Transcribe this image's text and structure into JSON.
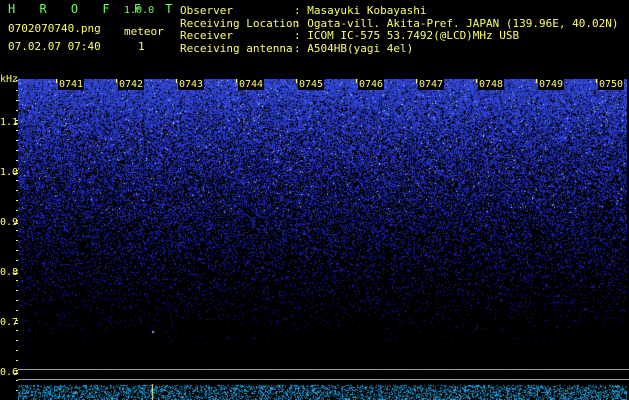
{
  "app": {
    "title_letters": "H R O F F T",
    "version": "1.0.0"
  },
  "file": {
    "name": "0702070740.png",
    "datetime": "07.02.07 07:40"
  },
  "meteor": {
    "label": "meteor",
    "count": "1"
  },
  "meta": [
    {
      "label": "Observer",
      "value": ": Masayuki Kobayashi"
    },
    {
      "label": "Receiving Location",
      "value": ": Ogata-vill. Akita-Pref. JAPAN (139.96E, 40.02N)"
    },
    {
      "label": "Receiver",
      "value": ": ICOM IC-575 53.7492(@LCD)MHz USB"
    },
    {
      "label": "Receiving antenna",
      "value": ": A504HB(yagi 4el)"
    }
  ],
  "y_axis": {
    "unit": "kHz",
    "ticks": [
      "1.1",
      "1.0",
      "0.9",
      "0.8",
      "0.7",
      "0.6"
    ]
  },
  "x_axis": {
    "ticks": [
      "0741",
      "0742",
      "0743",
      "0744",
      "0745",
      "0746",
      "0747",
      "0748",
      "0749",
      "0750"
    ]
  },
  "colors": {
    "label_yellow": "#ffff6a",
    "title_green": "#6cff5a",
    "noise_blue": "#2a3cff",
    "background": "#000000"
  }
}
